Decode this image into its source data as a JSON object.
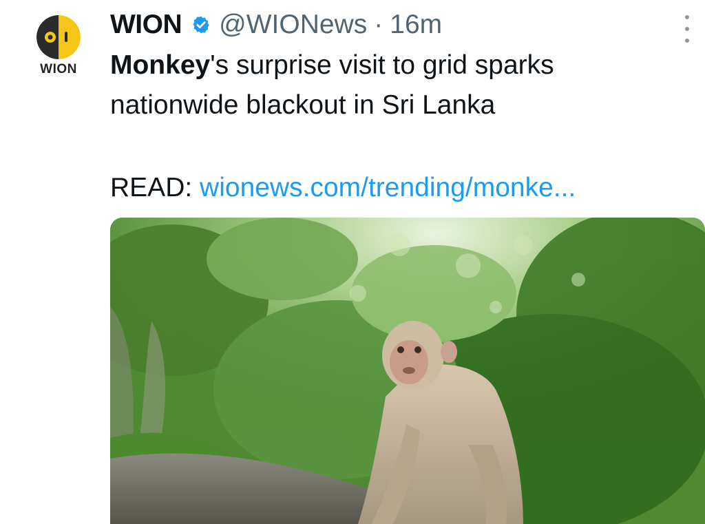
{
  "tweet": {
    "author": {
      "avatar_wordmark": "WION",
      "name": "WION",
      "handle": "@WIONews",
      "separator": "·",
      "timestamp": "16m",
      "verified_icon": "verified-badge-icon"
    },
    "text": {
      "highlight": "Monkey",
      "rest": "'s surprise visit to grid sparks nationwide blackout in Sri Lanka"
    },
    "read_line": {
      "prefix": "READ:",
      "link_text": "wionews.com/trending/monke..."
    },
    "media": {
      "image_icon": "monkey-photo"
    },
    "more_icon": "more-vertical-icon"
  },
  "colors": {
    "link": "#1d9bf0",
    "verified": "#1d9bf0",
    "muted": "#536471",
    "avatar_yellow": "#f5c518"
  }
}
